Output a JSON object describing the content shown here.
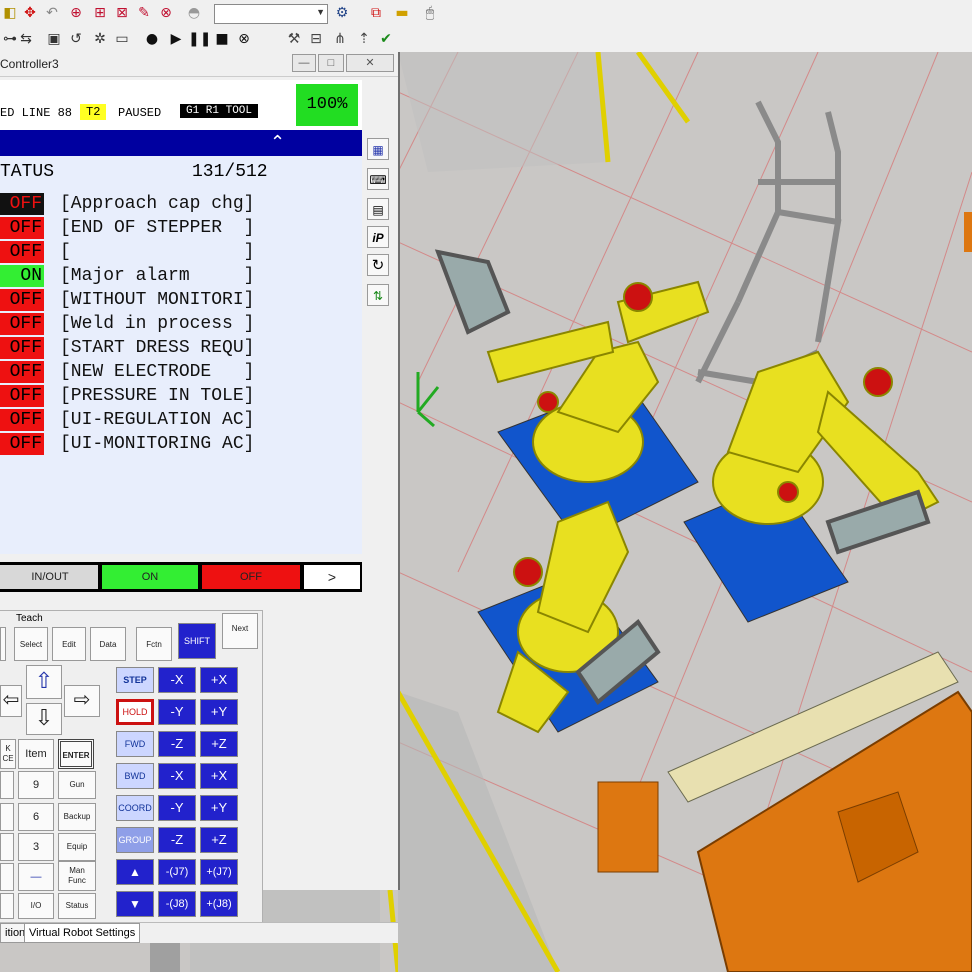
{
  "window": {
    "title": "Controller3",
    "min_btn": "—",
    "max_btn": "□",
    "close_btn": "✕"
  },
  "toolbar_icons": [
    "move-icon",
    "snap-icon",
    "undo-icon",
    "robot-add-icon",
    "robot-remove-icon",
    "teach-icon",
    "hide-icon",
    "view-icon",
    "dropdown-icon",
    "teach-pendant-icon",
    "note-icon",
    "mouse-icon"
  ],
  "toolbar": {
    "combo_value": ""
  },
  "pendant": {
    "status": {
      "line_text": "ED LINE 88",
      "mode": "T2",
      "state": "PAUSED",
      "group_tool": "G1 R1 TOOL",
      "override": "100%"
    },
    "header": {
      "title": "TATUS",
      "count": "131/512"
    },
    "rows": [
      {
        "state": "OFF",
        "comment": "[Approach cap chg]",
        "highlight": true
      },
      {
        "state": "OFF",
        "comment": "[END OF STEPPER  ]",
        "highlight": false
      },
      {
        "state": "OFF",
        "comment": "[                ]",
        "highlight": false
      },
      {
        "state": "ON",
        "comment": "[Major alarm     ]",
        "highlight": false
      },
      {
        "state": "OFF",
        "comment": "[WITHOUT MONITORI]",
        "highlight": false
      },
      {
        "state": "OFF",
        "comment": "[Weld in process ]",
        "highlight": false
      },
      {
        "state": "OFF",
        "comment": "[START DRESS REQU]",
        "highlight": false
      },
      {
        "state": "OFF",
        "comment": "[NEW ELECTRODE   ]",
        "highlight": false
      },
      {
        "state": "OFF",
        "comment": "[PRESSURE IN TOLE]",
        "highlight": false
      },
      {
        "state": "OFF",
        "comment": "[UI-REGULATION AC]",
        "highlight": false
      },
      {
        "state": "OFF",
        "comment": "[UI-MONITORING AC]",
        "highlight": false
      }
    ],
    "fkeys": {
      "f2": "IN/OUT",
      "f3": "ON",
      "f4": "OFF",
      "next": ">"
    }
  },
  "keypad": {
    "teach_label": "Teach",
    "select": "Select",
    "edit": "Edit",
    "data": "Data",
    "fctn": "Fctn",
    "shift": "SHIFT",
    "next": "Next",
    "item": "Item",
    "enter": "ENTER",
    "k_back": "K\nCE",
    "num9": "9",
    "num6": "6",
    "num3": "3",
    "dash": "—",
    "gun": "Gun",
    "backup": "Backup",
    "equip": "Equip",
    "man_func": "Man\nFunc",
    "io": "I/O",
    "status": "Status",
    "step": "STEP",
    "hold": "HOLD",
    "fwd": "FWD",
    "bwd": "BWD",
    "coord": "COORD",
    "group": "GROUP",
    "mx": "-X",
    "px": "+X",
    "my": "-Y",
    "py": "+Y",
    "mz": "-Z",
    "pz": "+Z",
    "mrx": "-X",
    "prx": "+X",
    "mry": "-Y",
    "pry": "+Y",
    "mrz": "-Z",
    "prz": "+Z",
    "mj7": "-(J7)",
    "pj7": "+(J7)",
    "mj8": "-(J8)",
    "pj8": "+(J8)"
  },
  "tabs": {
    "t1": "ition",
    "t2": "Virtual Robot Settings"
  },
  "side_icons": [
    "keypad-icon",
    "keyboard-icon",
    "pendant-icon",
    "ipendant-icon",
    "refresh-icon",
    "tree-icon"
  ],
  "side_labels": {
    "ip": "iP"
  },
  "colors": {
    "off_red": "#ee1111",
    "on_green": "#33ee33",
    "lcd_bg": "#e8eefc",
    "blue_band": "#0000a0",
    "key_blue": "#2222cc",
    "robot_yellow": "#e8e020",
    "base_blue": "#1155cc",
    "fixture_orange": "#dd7711",
    "floor_gray": "#c9c7c5"
  }
}
